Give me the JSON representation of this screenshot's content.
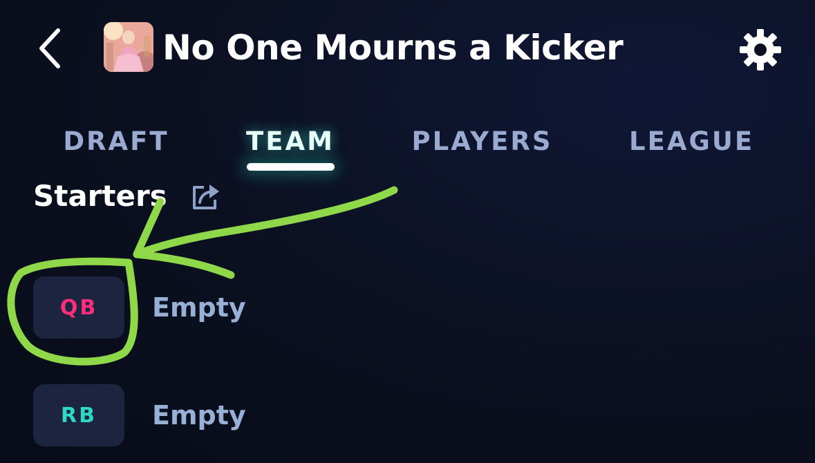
{
  "header": {
    "back_icon": "chevron-left-icon",
    "league_title": "No One Mourns a Kicker",
    "settings_icon": "gear-icon"
  },
  "tabs": [
    {
      "label": "DRAFT",
      "active": false
    },
    {
      "label": "TEAM",
      "active": true
    },
    {
      "label": "PLAYERS",
      "active": false
    },
    {
      "label": "LEAGUE",
      "active": false
    }
  ],
  "starters": {
    "title": "Starters",
    "share_icon": "share-icon",
    "rows": [
      {
        "position": "QB",
        "position_color": "#ff2d7a",
        "player": "Empty"
      },
      {
        "position": "RB",
        "position_color": "#2fd8c4",
        "player": "Empty"
      }
    ]
  },
  "colors": {
    "background": "#0b1020",
    "badge_bg": "#1c2440",
    "tab_inactive": "#9aaad0",
    "annotation": "#8fd84a"
  }
}
